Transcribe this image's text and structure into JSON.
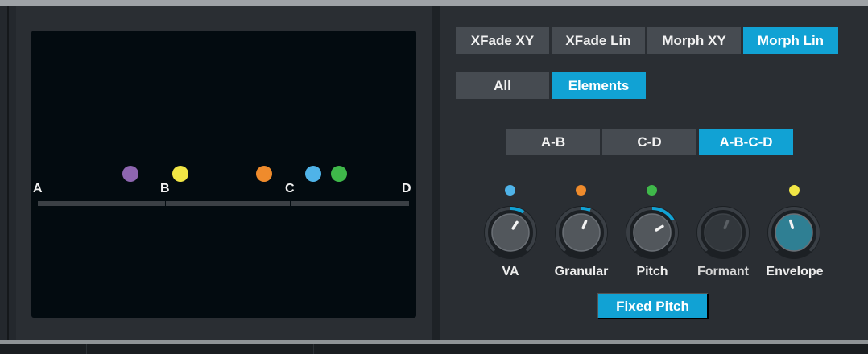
{
  "mode_tabs": [
    {
      "label": "XFade XY",
      "active": false
    },
    {
      "label": "XFade Lin",
      "active": false
    },
    {
      "label": "Morph XY",
      "active": false
    },
    {
      "label": "Morph Lin",
      "active": true
    }
  ],
  "scope_tabs": [
    {
      "label": "All",
      "active": false
    },
    {
      "label": "Elements",
      "active": true
    }
  ],
  "segment_tabs": [
    {
      "label": "A-B",
      "active": false
    },
    {
      "label": "C-D",
      "active": false
    },
    {
      "label": "A-B-C-D",
      "active": true
    }
  ],
  "pad_labels": {
    "a": "A",
    "b": "B",
    "c": "C",
    "d": "D"
  },
  "point_colors": {
    "va": "#4fb3e8",
    "granular": "#ef8b2c",
    "pitch": "#3fb84a",
    "envelope": "#f1e645",
    "purple": "#8e66b0"
  },
  "knobs": [
    {
      "label": "VA",
      "value": 0.62,
      "enabled": true
    },
    {
      "label": "Granular",
      "value": 0.58,
      "enabled": true
    },
    {
      "label": "Pitch",
      "value": 0.72,
      "enabled": true
    },
    {
      "label": "Formant",
      "value": 0.58,
      "enabled": false
    },
    {
      "label": "Envelope",
      "value": 0.44,
      "enabled": true
    }
  ],
  "fixed_pitch_label": "Fixed Pitch",
  "accent_color": "#11a2d4"
}
